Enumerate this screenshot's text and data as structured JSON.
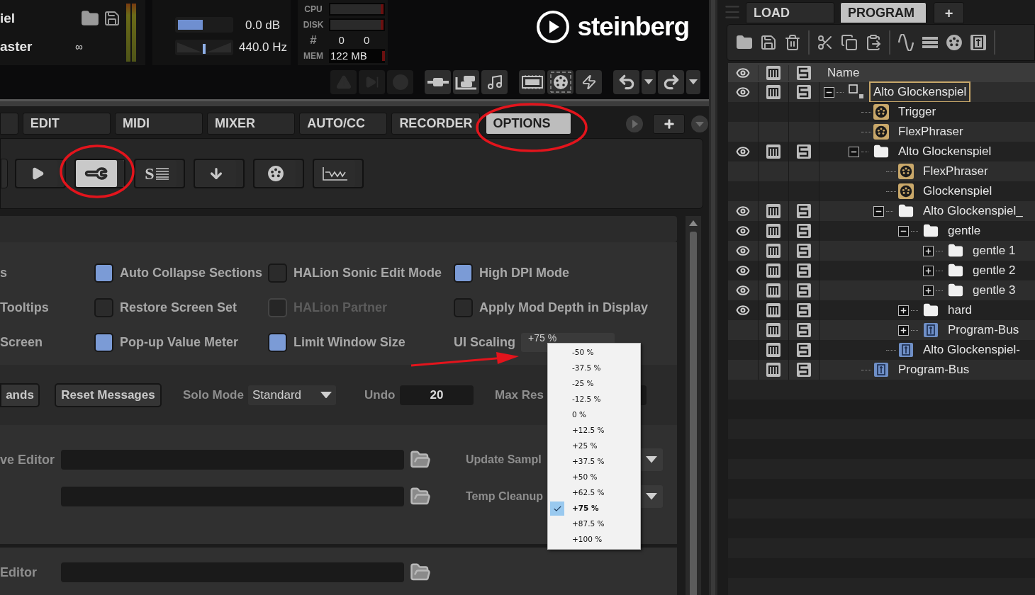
{
  "header": {
    "program": {
      "name": "iel",
      "output": "aster",
      "loop": "∞"
    },
    "volume": {
      "level": 0.47,
      "reading": "0.0 dB"
    },
    "tune": {
      "level": 0.5,
      "reading": "440.0 Hz"
    },
    "performance": {
      "cpu_label": "CPU",
      "disk_label": "DISK",
      "voices_label": "#",
      "voices": [
        "0",
        "0"
      ],
      "mem_label": "MEM",
      "mem": "122 MB"
    },
    "logo": "steinberg",
    "toolbar": [
      {
        "kind": "warning",
        "disabled": true
      },
      {
        "kind": "skip",
        "disabled": true
      },
      {
        "kind": "solo",
        "disabled": true
      },
      {
        "kind": "insert",
        "disabled": false
      },
      {
        "kind": "insert-stack",
        "disabled": false
      },
      {
        "kind": "notes",
        "disabled": false
      },
      {
        "kind": "ram",
        "disabled": false
      },
      {
        "kind": "midi-port",
        "disabled": false
      },
      {
        "kind": "lightning",
        "disabled": false
      },
      {
        "kind": "undo",
        "disabled": false
      },
      {
        "kind": "caret",
        "disabled": false
      },
      {
        "kind": "redo",
        "disabled": false
      },
      {
        "kind": "caret",
        "disabled": false
      }
    ]
  },
  "tabs": [
    {
      "label": "EDIT",
      "selected": false
    },
    {
      "label": "MIDI",
      "selected": false
    },
    {
      "label": "MIXER",
      "selected": false
    },
    {
      "label": "AUTO/CC",
      "selected": false
    },
    {
      "label": "RECORDER",
      "selected": false
    },
    {
      "label": "OPTIONS",
      "selected": true
    }
  ],
  "pages": [
    {
      "kind": "play",
      "selected": false
    },
    {
      "kind": "wrench",
      "selected": true
    },
    {
      "kind": "solo-list",
      "label": "S",
      "selected": false
    },
    {
      "kind": "download",
      "selected": false
    },
    {
      "kind": "midi",
      "selected": false
    },
    {
      "kind": "wave",
      "selected": false
    }
  ],
  "options": [
    {
      "kind": "label",
      "label": "s"
    },
    {
      "kind": "checkbox",
      "label": "Auto Collapse Sections",
      "checked": true,
      "disabled": false
    },
    {
      "kind": "checkbox",
      "label": "HALion Sonic Edit Mode",
      "checked": false,
      "disabled": false
    },
    {
      "kind": "checkbox",
      "label": "High DPI Mode",
      "checked": true,
      "disabled": false
    },
    {
      "kind": "label",
      "label": "Tooltips"
    },
    {
      "kind": "checkbox",
      "label": "Restore Screen Set",
      "checked": false,
      "disabled": false
    },
    {
      "kind": "checkbox",
      "label": "HALion Partner",
      "checked": false,
      "disabled": true
    },
    {
      "kind": "checkbox",
      "label": "Apply Mod Depth in Display",
      "checked": false,
      "disabled": false
    },
    {
      "kind": "label",
      "label": "Screen"
    },
    {
      "kind": "checkbox",
      "label": "Pop-up Value Meter",
      "checked": true,
      "disabled": false
    },
    {
      "kind": "checkbox",
      "label": "Limit Window Size",
      "checked": true,
      "disabled": false
    },
    {
      "kind": "select",
      "label": "UI Scaling",
      "value": "+75 %"
    }
  ],
  "actions": {
    "buttons": [
      "ands",
      "Reset Messages"
    ],
    "solo_mode": {
      "label": "Solo Mode",
      "value": "Standard"
    },
    "undo": {
      "label": "Undo",
      "value": "20"
    },
    "max": {
      "label": "Max Res"
    }
  },
  "paths": [
    {
      "label": "ve Editor"
    }
  ],
  "cleanup": [
    {
      "label": "Update Sampl"
    },
    {
      "label": "Temp Cleanup"
    }
  ],
  "last_path": {
    "label": "Editor"
  },
  "ui_scaling_menu": [
    {
      "label": "-50 %",
      "selected": false
    },
    {
      "label": "-37.5 %",
      "selected": false
    },
    {
      "label": "-25 %",
      "selected": false
    },
    {
      "label": "-12.5 %",
      "selected": false
    },
    {
      "label": "0 %",
      "selected": false
    },
    {
      "label": "+12.5 %",
      "selected": false
    },
    {
      "label": "+25 %",
      "selected": false
    },
    {
      "label": "+37.5 %",
      "selected": false
    },
    {
      "label": "+50 %",
      "selected": false
    },
    {
      "label": "+62.5 %",
      "selected": false
    },
    {
      "label": "+75 %",
      "selected": true
    },
    {
      "label": "+87.5 %",
      "selected": false
    },
    {
      "label": "+100 %",
      "selected": false
    }
  ],
  "browser": {
    "tabs": [
      {
        "label": "LOAD",
        "selected": false
      },
      {
        "label": "PROGRAM",
        "selected": true
      }
    ],
    "add_tab": "+",
    "name_column": "Name",
    "tree": [
      {
        "name": "Alto Glockenspiel",
        "kind": "program",
        "expanded": true,
        "selected": true,
        "has_eye": true,
        "has_mute_solo": true,
        "children": [
          {
            "name": "Trigger",
            "kind": "midi",
            "selected": false,
            "has_eye": false,
            "has_mute_solo": false
          },
          {
            "name": "FlexPhraser",
            "kind": "midi",
            "selected": false,
            "has_eye": false,
            "has_mute_solo": false
          },
          {
            "name": "Alto Glockenspiel",
            "kind": "folder",
            "expanded": true,
            "selected": false,
            "has_eye": true,
            "has_mute_solo": true,
            "children": [
              {
                "name": "FlexPhraser",
                "kind": "midi",
                "selected": false,
                "has_eye": false,
                "has_mute_solo": false
              },
              {
                "name": "Glockenspiel",
                "kind": "midi",
                "selected": false,
                "has_eye": false,
                "has_mute_solo": false
              },
              {
                "name": "Alto Glockenspiel_",
                "kind": "folder",
                "expanded": true,
                "selected": false,
                "has_eye": true,
                "has_mute_solo": true,
                "children": [
                  {
                    "name": "gentle",
                    "kind": "folder",
                    "expanded": true,
                    "selected": false,
                    "has_eye": true,
                    "has_mute_solo": true,
                    "children": [
                      {
                        "name": "gentle 1",
                        "kind": "folder",
                        "expanded": false,
                        "selected": false,
                        "has_eye": true,
                        "has_mute_solo": true
                      },
                      {
                        "name": "gentle 2",
                        "kind": "folder",
                        "expanded": false,
                        "selected": false,
                        "has_eye": true,
                        "has_mute_solo": true
                      },
                      {
                        "name": "gentle 3",
                        "kind": "folder",
                        "expanded": false,
                        "selected": false,
                        "has_eye": true,
                        "has_mute_solo": true
                      }
                    ]
                  },
                  {
                    "name": "hard",
                    "kind": "folder",
                    "expanded": false,
                    "selected": false,
                    "has_eye": true,
                    "has_mute_solo": true
                  },
                  {
                    "name": "Program-Bus",
                    "kind": "bus",
                    "expanded": false,
                    "selected": false,
                    "has_eye": false,
                    "has_mute_solo": true
                  }
                ]
              },
              {
                "name": "Alto Glockenspiel-",
                "kind": "bus",
                "selected": false,
                "has_eye": false,
                "has_mute_solo": true
              }
            ]
          },
          {
            "name": "Program-Bus",
            "kind": "bus",
            "selected": false,
            "has_eye": false,
            "has_mute_solo": true
          }
        ]
      }
    ]
  }
}
